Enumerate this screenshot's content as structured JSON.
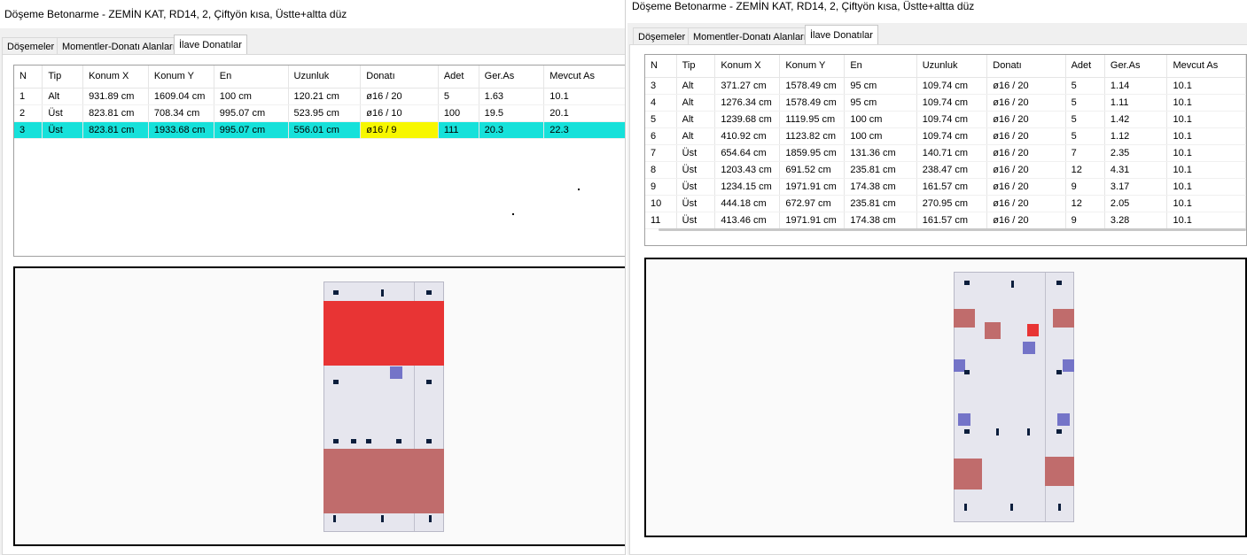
{
  "left_window": {
    "title": "Döşeme Betonarme - ZEMİN KAT, RD14, 2, Çiftyön kısa, Üstte+altta düz",
    "tabs": [
      {
        "label": "Döşemeler",
        "active": false
      },
      {
        "label": "Momentler-Donatı Alanları",
        "active": false
      },
      {
        "label": "İlave Donatılar",
        "active": true
      }
    ],
    "columns": [
      "N",
      "Tip",
      "Konum X",
      "Konum Y",
      "En",
      "Uzunluk",
      "Donatı",
      "Adet",
      "Ger.As",
      "Mevcut As"
    ],
    "rows": [
      [
        "1",
        "Alt",
        "931.89 cm",
        "1609.04 cm",
        "100 cm",
        "120.21 cm",
        "ø16 / 20",
        "5",
        "1.63",
        "10.1"
      ],
      [
        "2",
        "Üst",
        "823.81 cm",
        "708.34 cm",
        "995.07 cm",
        "523.95 cm",
        "ø16 / 10",
        "100",
        "19.5",
        "20.1"
      ],
      [
        "3",
        "Üst",
        "823.81 cm",
        "1933.68 cm",
        "995.07 cm",
        "556.01 cm",
        "ø16 / 9",
        "111",
        "20.3",
        "22.3"
      ]
    ],
    "selected_row": 3,
    "highlighted_cell": "ø16 / 9"
  },
  "right_window": {
    "title": "Döşeme Betonarme - ZEMİN KAT, RD14, 2, Çiftyön kısa, Üstte+altta düz",
    "tabs": [
      {
        "label": "Döşemeler",
        "active": false
      },
      {
        "label": "Momentler-Donatı Alanları",
        "active": false
      },
      {
        "label": "İlave Donatılar",
        "active": true
      }
    ],
    "columns": [
      "N",
      "Tip",
      "Konum X",
      "Konum Y",
      "En",
      "Uzunluk",
      "Donatı",
      "Adet",
      "Ger.As",
      "Mevcut As"
    ],
    "rows": [
      [
        "3",
        "Alt",
        "371.27 cm",
        "1578.49 cm",
        "95 cm",
        "109.74 cm",
        "ø16 / 20",
        "5",
        "1.14",
        "10.1"
      ],
      [
        "4",
        "Alt",
        "1276.34 cm",
        "1578.49 cm",
        "95 cm",
        "109.74 cm",
        "ø16 / 20",
        "5",
        "1.11",
        "10.1"
      ],
      [
        "5",
        "Alt",
        "1239.68 cm",
        "1119.95 cm",
        "100 cm",
        "109.74 cm",
        "ø16 / 20",
        "5",
        "1.42",
        "10.1"
      ],
      [
        "6",
        "Alt",
        "410.92 cm",
        "1123.82 cm",
        "100 cm",
        "109.74 cm",
        "ø16 / 20",
        "5",
        "1.12",
        "10.1"
      ],
      [
        "7",
        "Üst",
        "654.64 cm",
        "1859.95 cm",
        "131.36 cm",
        "140.71 cm",
        "ø16 / 20",
        "7",
        "2.35",
        "10.1"
      ],
      [
        "8",
        "Üst",
        "1203.43 cm",
        "691.52 cm",
        "235.81 cm",
        "238.47 cm",
        "ø16 / 20",
        "12",
        "4.31",
        "10.1"
      ],
      [
        "9",
        "Üst",
        "1234.15 cm",
        "1971.91 cm",
        "174.38 cm",
        "161.57 cm",
        "ø16 / 20",
        "9",
        "3.17",
        "10.1"
      ],
      [
        "10",
        "Üst",
        "444.18 cm",
        "672.97 cm",
        "235.81 cm",
        "270.95 cm",
        "ø16 / 20",
        "12",
        "2.05",
        "10.1"
      ],
      [
        "11",
        "Üst",
        "413.46 cm",
        "1971.91 cm",
        "174.38 cm",
        "161.57 cm",
        "ø16 / 20",
        "9",
        "3.28",
        "10.1"
      ]
    ]
  },
  "colors": {
    "selected_row": "#16e1da",
    "highlight_cell": "#f7f700",
    "zone_selected": "#e83434",
    "zone_top": "#c06c6c",
    "zone_bottom": "#7474c8",
    "slab": "#e6e6ee",
    "rebar_mark": "#0b1e3c"
  }
}
